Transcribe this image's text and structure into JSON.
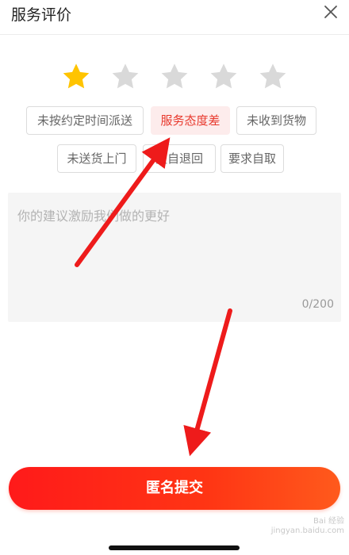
{
  "header": {
    "title": "服务评价",
    "close_icon": "close-icon"
  },
  "rating": {
    "value": 1,
    "max": 5,
    "filled_color": "#FFC400",
    "empty_color": "#D9D9D9"
  },
  "tags": [
    {
      "label": "未按约定时间派送",
      "selected": false
    },
    {
      "label": "服务态度差",
      "selected": true
    },
    {
      "label": "未收到货物",
      "selected": false
    },
    {
      "label": "未送货上门",
      "selected": false
    },
    {
      "label": "擅自退回",
      "selected": false
    },
    {
      "label": "要求自取",
      "selected": false
    }
  ],
  "comment": {
    "placeholder": "你的建议激励我们做的更好",
    "counter": "0/200"
  },
  "submit": {
    "label": "匿名提交"
  },
  "colors": {
    "accent": "#FF2A1A",
    "selected_tag_bg": "#FDECEC",
    "selected_tag_text": "#E8372B"
  },
  "watermark": {
    "line1": "Bai 经验",
    "line2": "jingyan.baidu.com"
  }
}
